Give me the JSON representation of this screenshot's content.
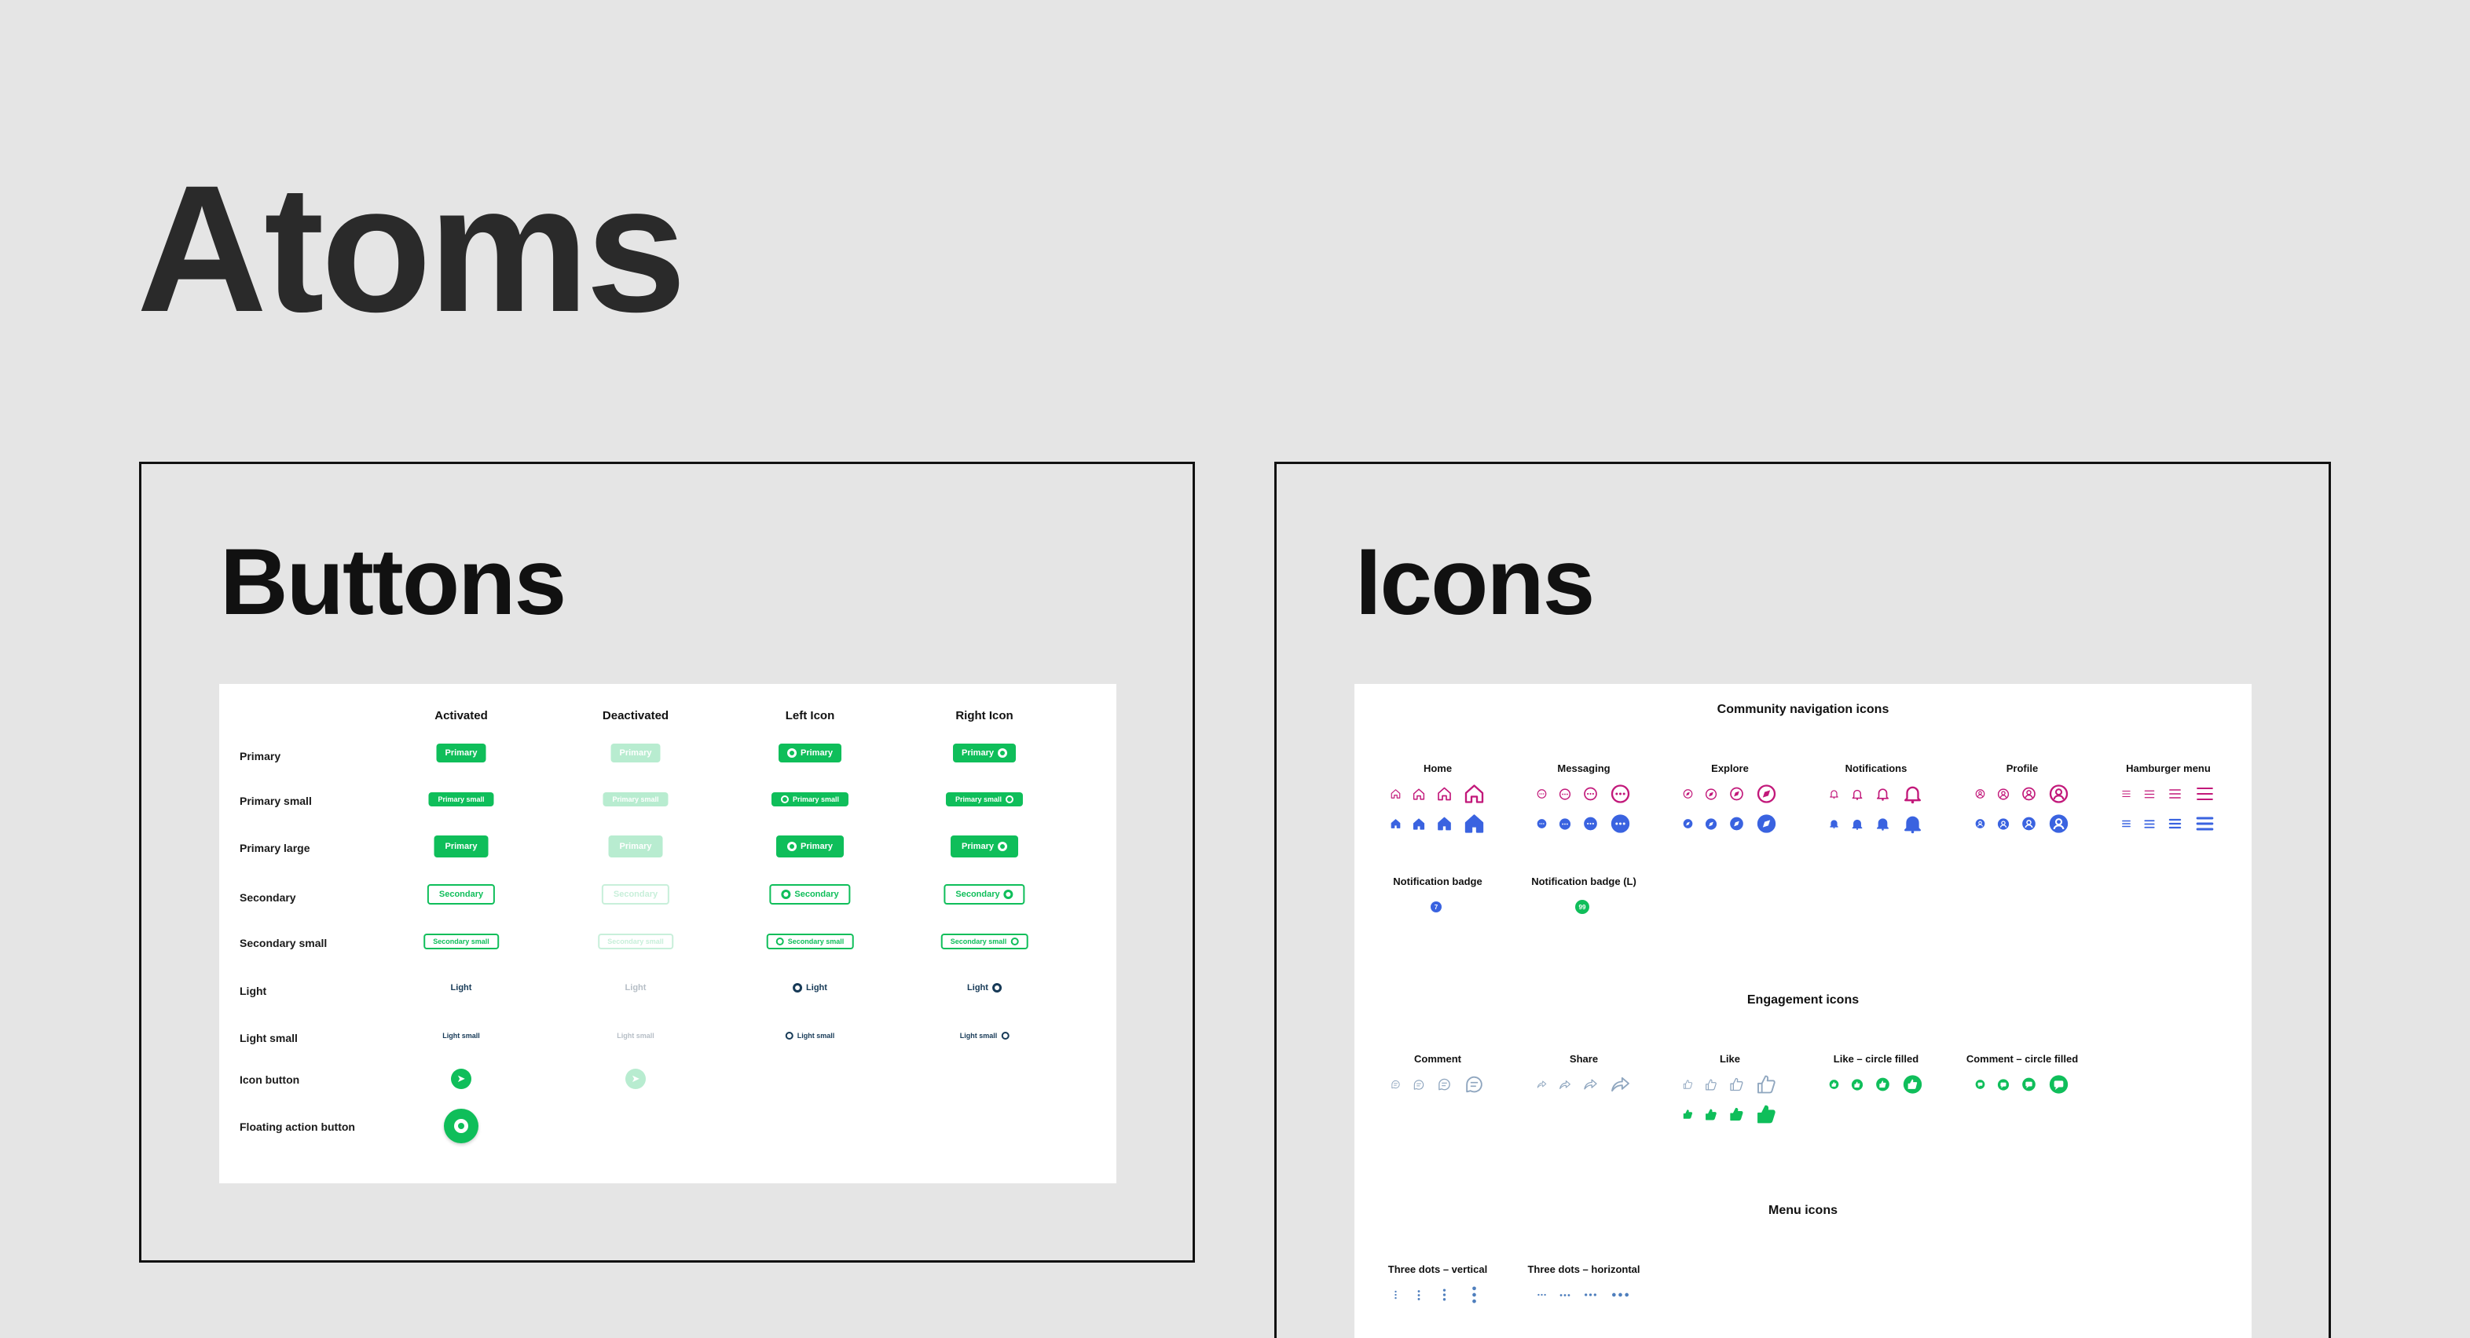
{
  "page": {
    "title": "Atoms"
  },
  "buttons": {
    "title": "Buttons",
    "columns": [
      "Activated",
      "Deactivated",
      "Left Icon",
      "Right Icon"
    ],
    "rows": [
      {
        "label": "Primary",
        "button_text": "Primary"
      },
      {
        "label": "Primary small",
        "button_text": "Primary small"
      },
      {
        "label": "Primary large",
        "button_text": "Primary"
      },
      {
        "label": "Secondary",
        "button_text": "Secondary"
      },
      {
        "label": "Secondary small",
        "button_text": "Secondary small"
      },
      {
        "label": "Light",
        "button_text": "Light"
      },
      {
        "label": "Light small",
        "button_text": "Light small"
      },
      {
        "label": "Icon button"
      },
      {
        "label": "Floating action button"
      }
    ],
    "colors": {
      "primary": "#0fbe5a",
      "primary_disabled": "#b8ecd0",
      "light_text": "#173a57"
    }
  },
  "icons": {
    "title": "Icons",
    "sections": {
      "community": {
        "title": "Community navigation icons",
        "groups": [
          "Home",
          "Messaging",
          "Explore",
          "Notifications",
          "Profile",
          "Hamburger menu"
        ],
        "badges": [
          {
            "label": "Notification badge",
            "value": "7"
          },
          {
            "label": "Notification badge (L)",
            "value": "99"
          }
        ]
      },
      "engagement": {
        "title": "Engagement icons",
        "groups": [
          "Comment",
          "Share",
          "Like",
          "Like – circle filled",
          "Comment – circle filled"
        ]
      },
      "menu": {
        "title": "Menu icons",
        "groups": [
          "Three dots – vertical",
          "Three dots – horizontal"
        ]
      }
    },
    "colors": {
      "outline": "#c2187a",
      "filled": "#3a63e0",
      "engagement": "#8fa6bf",
      "engagement_filled": "#0fbe5a",
      "menu": "#4f7fbd"
    }
  }
}
